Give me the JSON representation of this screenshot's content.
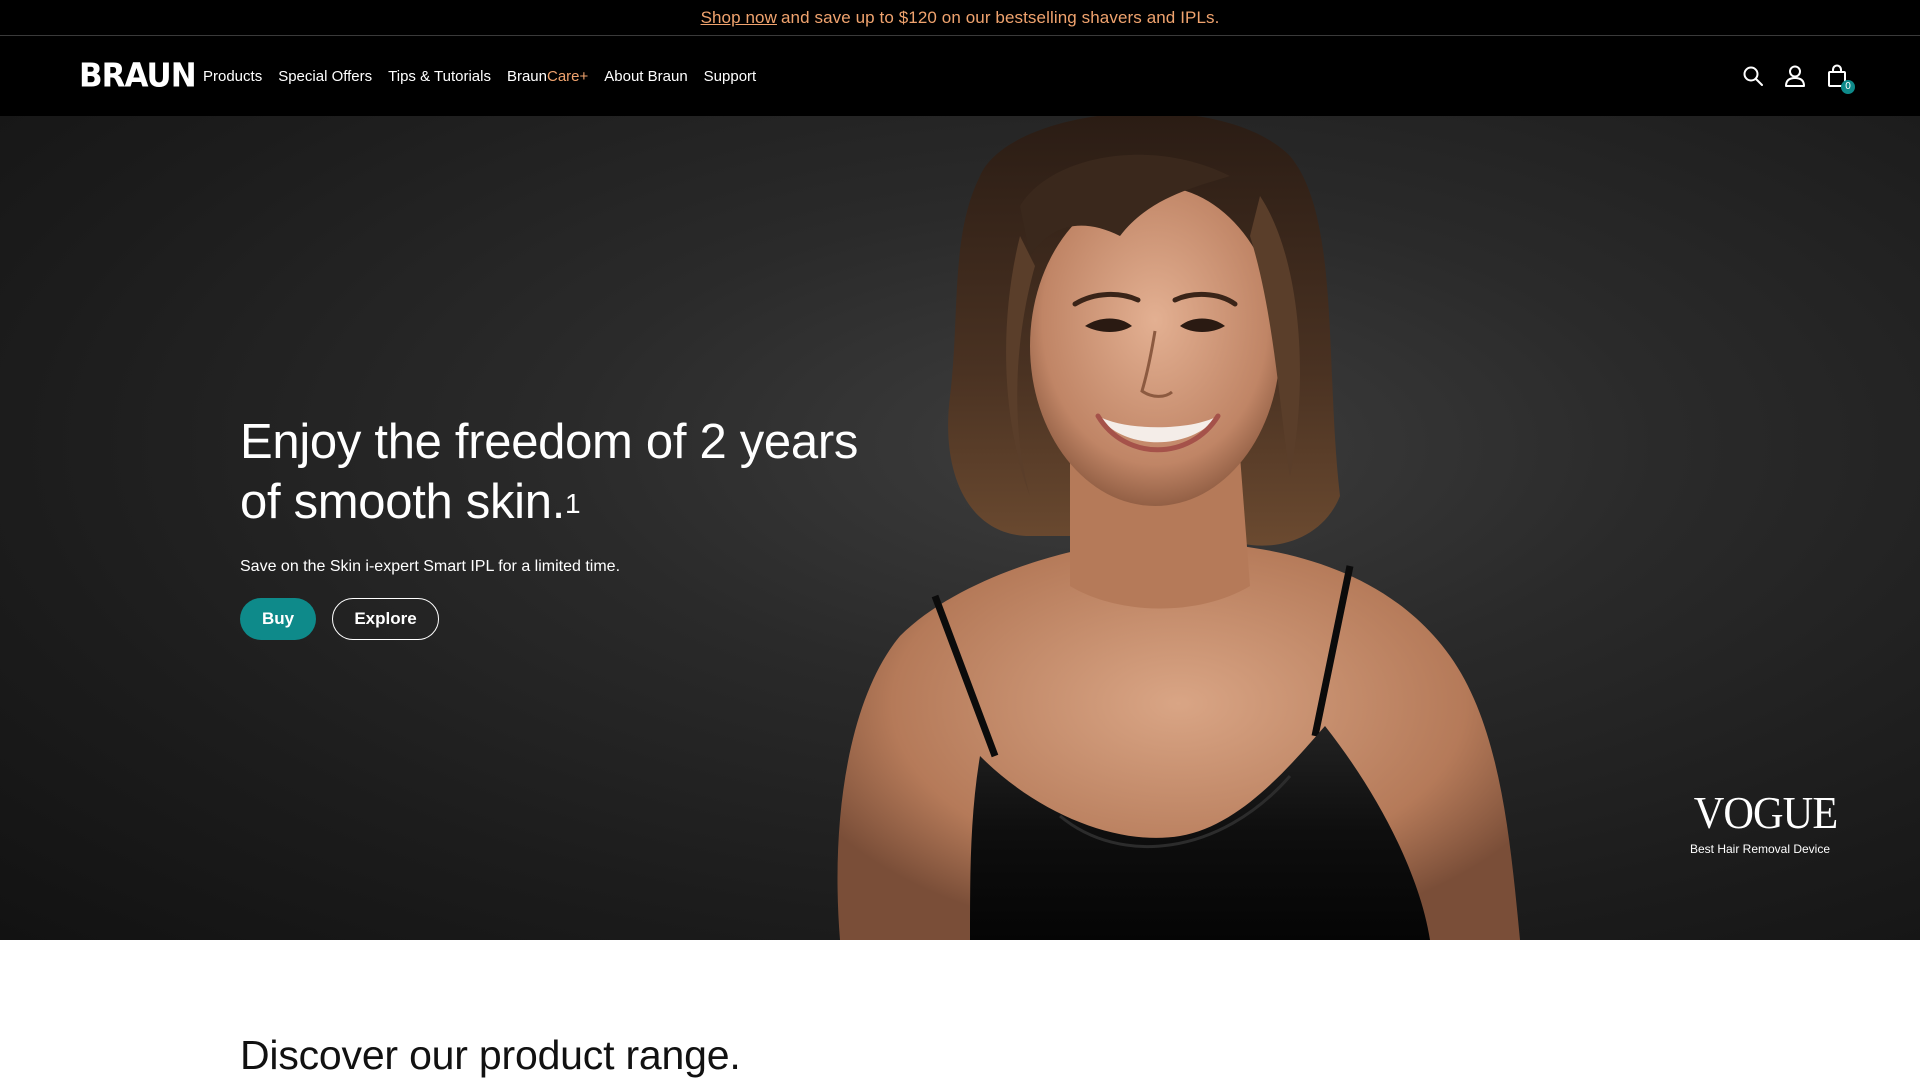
{
  "promo": {
    "link": "Shop now",
    "text": "and save up to $120 on our bestselling shavers and IPLs."
  },
  "header": {
    "logo": "BRAUN",
    "nav": [
      {
        "label": "Products"
      },
      {
        "label": "Special Offers"
      },
      {
        "label": "Tips & Tutorials"
      },
      {
        "label_a": "Braun",
        "label_b": "Care+"
      },
      {
        "label": "About Braun"
      },
      {
        "label": "Support"
      }
    ],
    "cart_count": "0",
    "icons": [
      "search-icon",
      "account-icon",
      "cart-icon"
    ]
  },
  "hero": {
    "title": "Enjoy the freedom of 2 years of smooth skin.",
    "title_sup": "1",
    "subtitle": "Save on the Skin i-expert Smart IPL for a limited time.",
    "buy_label": "Buy",
    "explore_label": "Explore",
    "award_logo": "VOGUE",
    "award_caption": "Best Hair Removal Device"
  },
  "discover": {
    "heading": "Discover our product range."
  },
  "colors": {
    "accent": "#0e8a8a",
    "promo_text": "#f0a36e",
    "background_dark": "#000000"
  }
}
